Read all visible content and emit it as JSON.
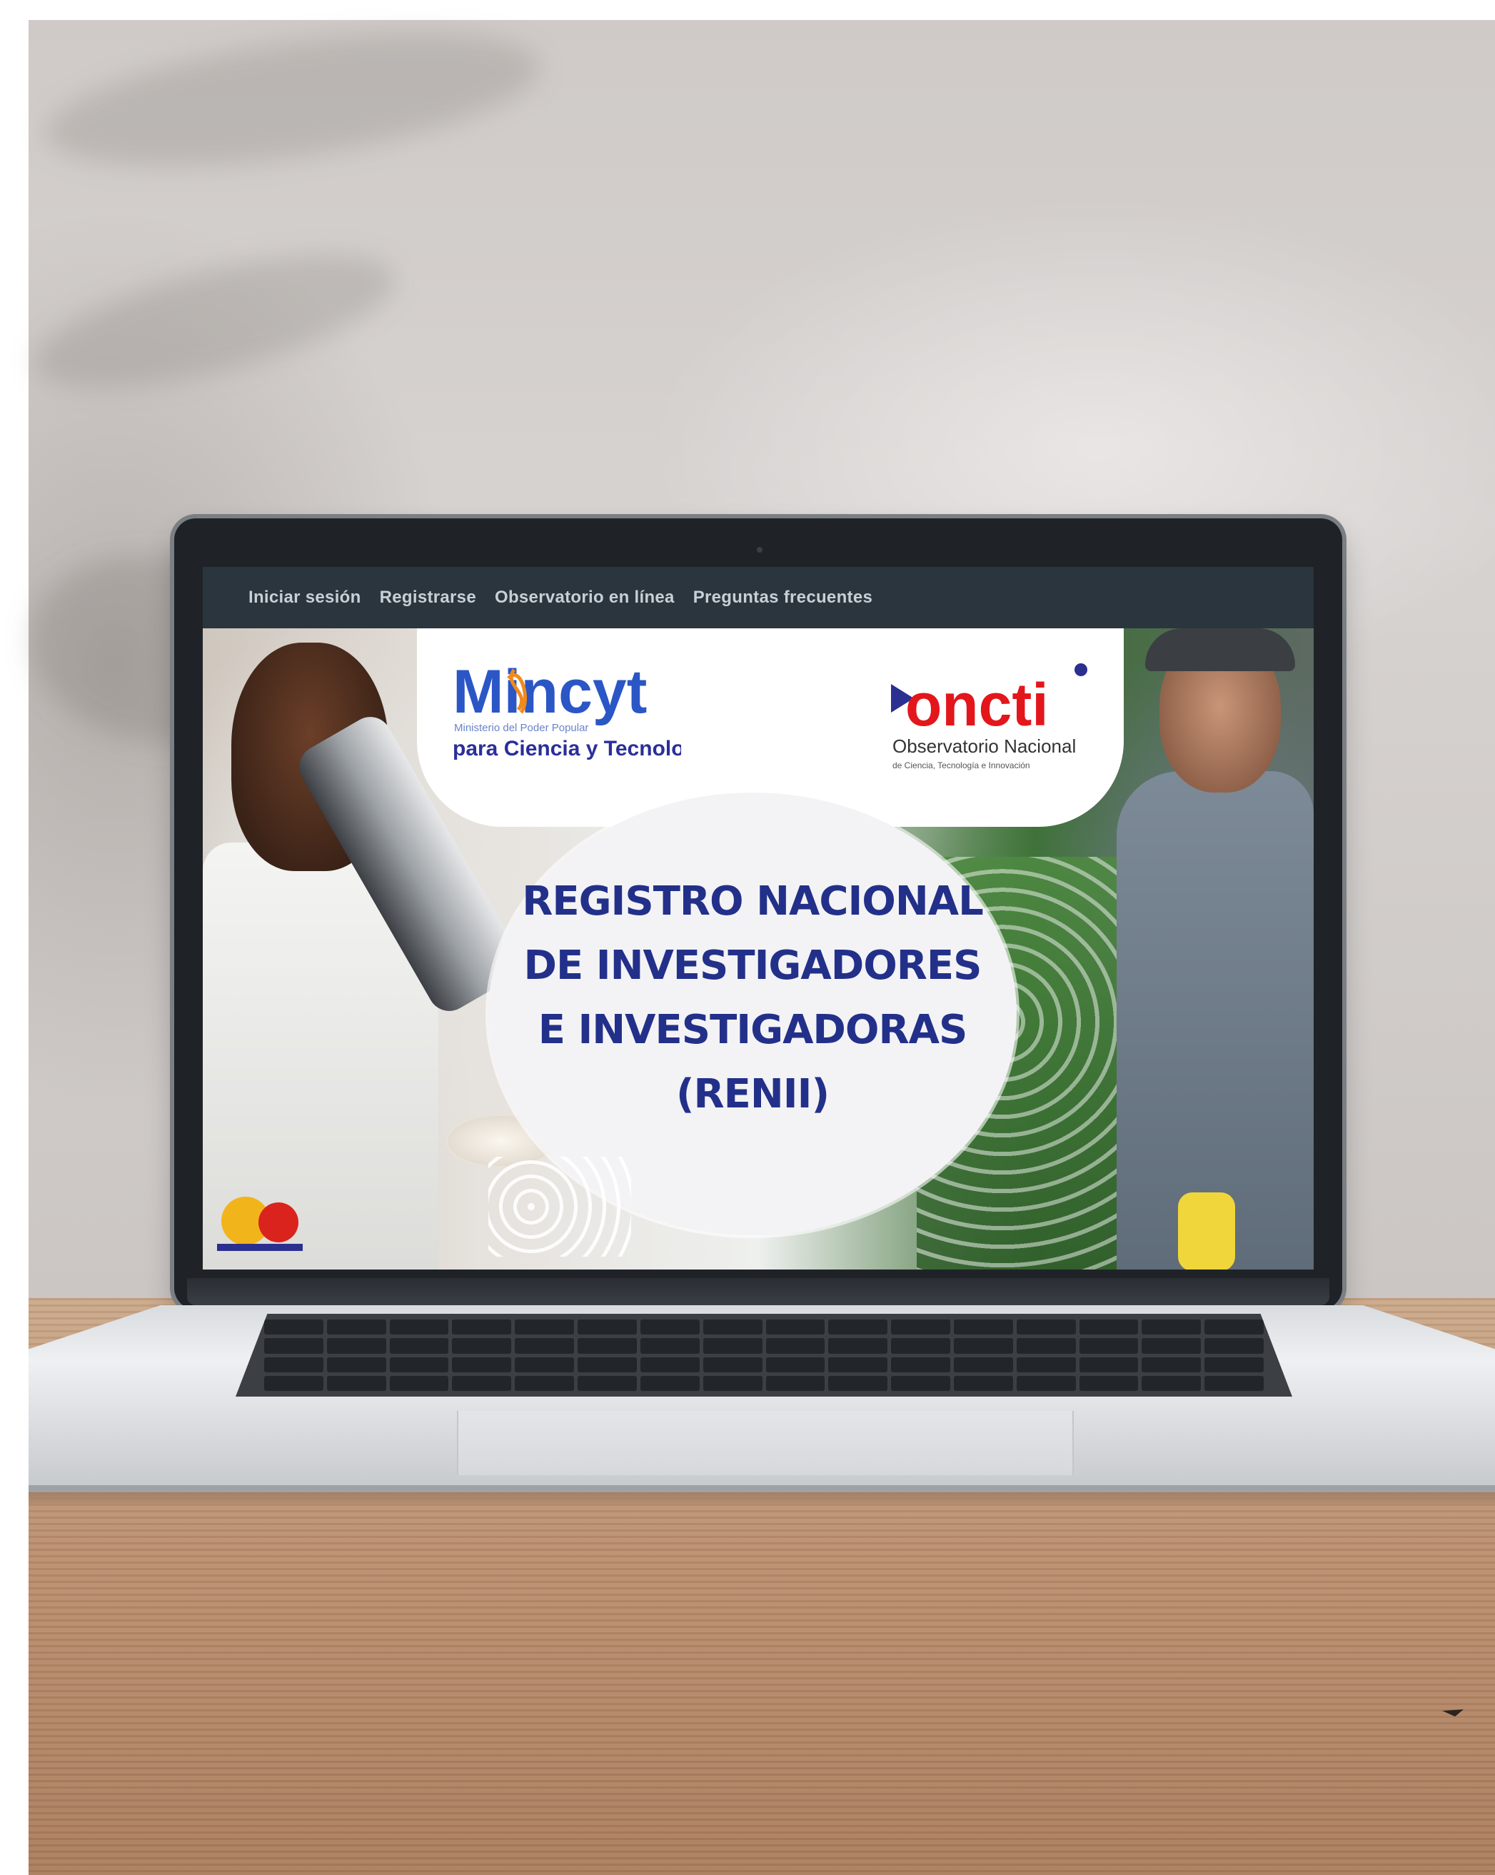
{
  "navbar": {
    "items": [
      {
        "label": "Iniciar sesión"
      },
      {
        "label": "Registrarse"
      },
      {
        "label": "Observatorio en línea"
      },
      {
        "label": "Preguntas frecuentes"
      }
    ]
  },
  "logos": {
    "mincyt": {
      "name": "Mincyt",
      "subtitle": "Ministerio del Poder Popular",
      "tagline": "para Ciencia y Tecnología"
    },
    "oncti": {
      "name": "oncti",
      "line1": "Observatorio Nacional",
      "line2": "de Ciencia, Tecnología e Innovación"
    }
  },
  "hero": {
    "title_lines": [
      "REGISTRO NACIONAL",
      "DE INVESTIGADORES",
      "E INVESTIGADORAS",
      "(RENII)"
    ]
  },
  "colors": {
    "navbar_bg": "#2b353e",
    "navbar_text": "#c8d0d6",
    "title_blue": "#23308a",
    "mincyt_blue": "#2a56c6",
    "oncti_red": "#e3161b"
  }
}
